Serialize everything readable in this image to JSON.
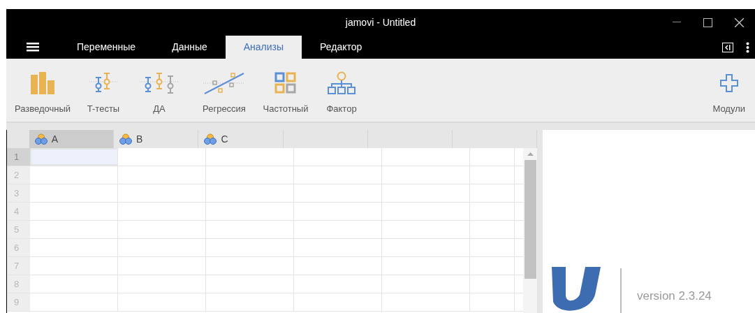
{
  "window": {
    "title": "jamovi - Untitled"
  },
  "tabs": [
    {
      "label": "Переменные",
      "selected": false
    },
    {
      "label": "Данные",
      "selected": false
    },
    {
      "label": "Анализы",
      "selected": true
    },
    {
      "label": "Редактор",
      "selected": false
    }
  ],
  "toolbar": {
    "items": [
      {
        "label": "Разведочный"
      },
      {
        "label": "T-тесты"
      },
      {
        "label": "ДА"
      },
      {
        "label": "Регрессия"
      },
      {
        "label": "Частотный"
      },
      {
        "label": "Фактор"
      }
    ],
    "modules": {
      "label": "Модули"
    }
  },
  "sheet": {
    "columns": [
      {
        "name": "A",
        "selected": true
      },
      {
        "name": "B",
        "selected": false
      },
      {
        "name": "C",
        "selected": false
      }
    ],
    "rows": [
      {
        "number": "1",
        "selected": true
      },
      {
        "number": "2",
        "selected": false
      },
      {
        "number": "3",
        "selected": false
      },
      {
        "number": "4",
        "selected": false
      },
      {
        "number": "5",
        "selected": false
      },
      {
        "number": "6",
        "selected": false
      },
      {
        "number": "7",
        "selected": false
      },
      {
        "number": "8",
        "selected": false
      },
      {
        "number": "9",
        "selected": false
      }
    ]
  },
  "results": {
    "version": "version 2.3.24"
  }
}
